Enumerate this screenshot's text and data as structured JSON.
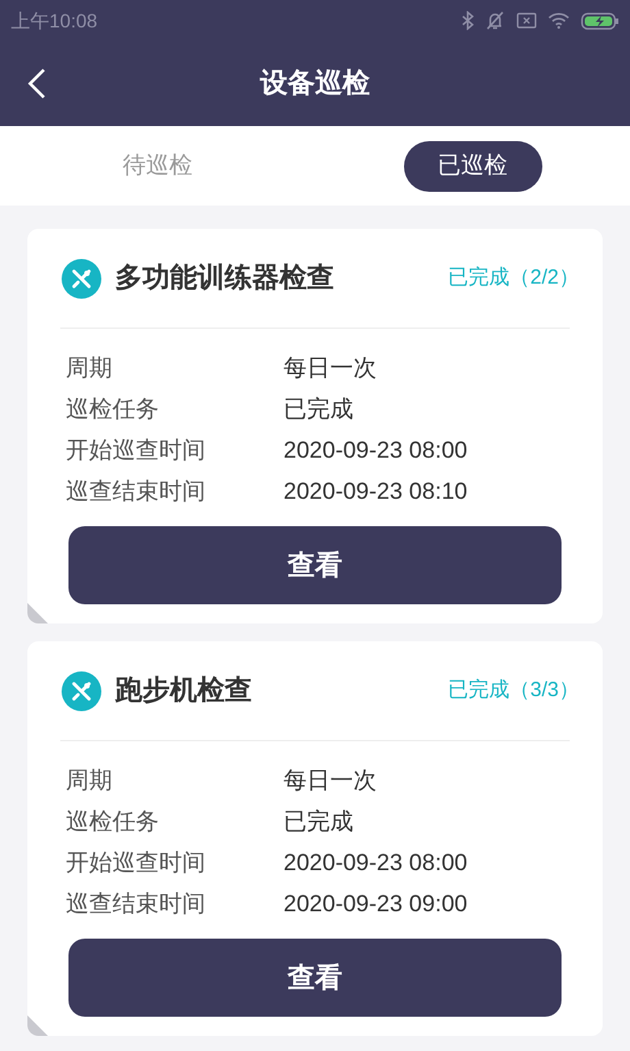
{
  "status_bar": {
    "time": "上午10:08"
  },
  "header": {
    "title": "设备巡检"
  },
  "tabs": [
    {
      "label": "待巡检",
      "selected": false
    },
    {
      "label": "已巡检",
      "selected": true
    }
  ],
  "cards": [
    {
      "title": "多功能训练器检查",
      "status": "已完成（2/2）",
      "fields": [
        {
          "label": "周期",
          "value": "每日一次"
        },
        {
          "label": "巡检任务",
          "value": "已完成"
        },
        {
          "label": "开始巡查时间",
          "value": "2020-09-23 08:00"
        },
        {
          "label": "巡查结束时间",
          "value": "2020-09-23 08:10"
        }
      ],
      "button": "查看"
    },
    {
      "title": "跑步机检查",
      "status": "已完成（3/3）",
      "fields": [
        {
          "label": "周期",
          "value": "每日一次"
        },
        {
          "label": "巡检任务",
          "value": "已完成"
        },
        {
          "label": "开始巡查时间",
          "value": "2020-09-23 08:00"
        },
        {
          "label": "巡查结束时间",
          "value": "2020-09-23 09:00"
        }
      ],
      "button": "查看"
    }
  ]
}
